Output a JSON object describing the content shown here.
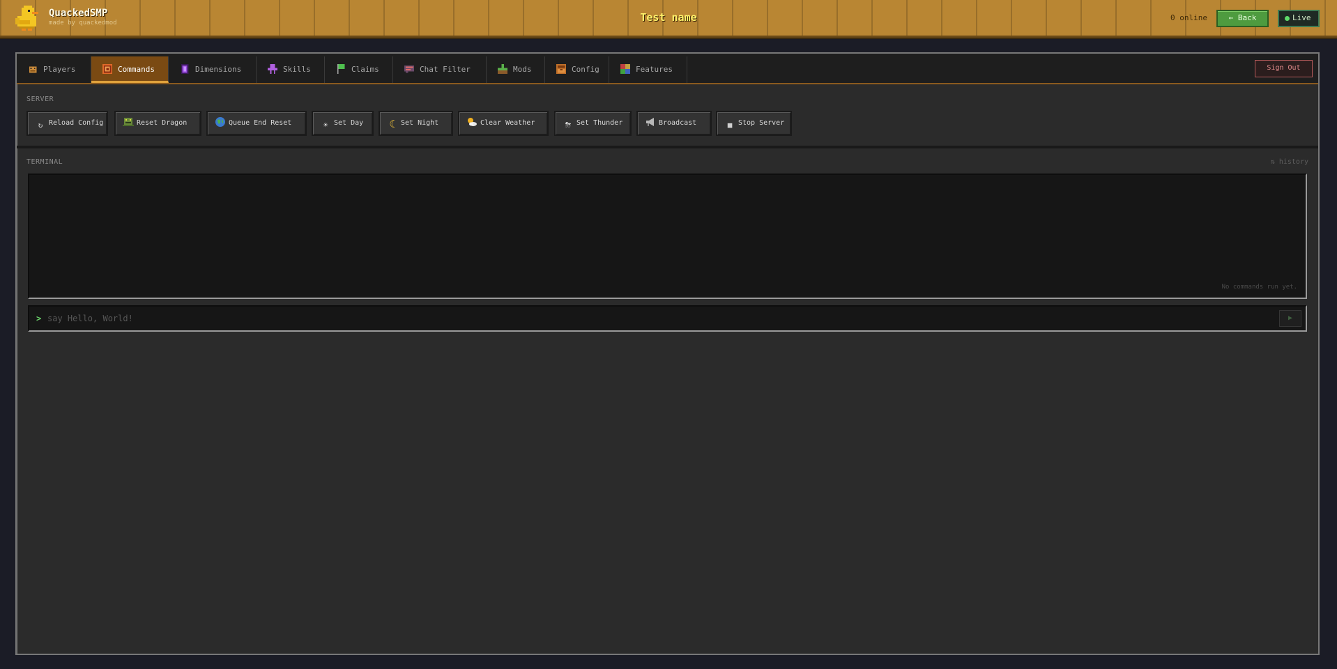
{
  "header": {
    "brand_name": "QuackedSMP",
    "brand_sub": "made by quackedmod",
    "page_title": "Test name",
    "online": "0 online",
    "back_label": "← Back",
    "live_label": "Live"
  },
  "tabs": [
    {
      "label": "Players",
      "icon": "players-icon",
      "active": false
    },
    {
      "label": "Commands",
      "icon": "commands-icon",
      "active": true
    },
    {
      "label": "Dimensions",
      "icon": "dimensions-icon",
      "active": false
    },
    {
      "label": "Skills",
      "icon": "skills-icon",
      "active": false
    },
    {
      "label": "Claims",
      "icon": "flag-icon",
      "active": false
    },
    {
      "label": "Chat Filter",
      "icon": "chat-filter-icon",
      "active": false
    },
    {
      "label": "Mods",
      "icon": "mods-icon",
      "active": false
    },
    {
      "label": "Config",
      "icon": "config-icon",
      "active": false
    },
    {
      "label": "Features",
      "icon": "features-icon",
      "active": false
    }
  ],
  "sign_out_label": "Sign Out",
  "server": {
    "section_label": "SERVER",
    "buttons": [
      {
        "label": "Reload Config",
        "icon": "reload-icon"
      },
      {
        "label": "Reset Dragon",
        "icon": "dragon-icon"
      },
      {
        "label": "Queue End Reset",
        "icon": "globe-icon"
      },
      {
        "label": "Set Day",
        "icon": "sun-icon"
      },
      {
        "label": "Set Night",
        "icon": "moon-icon"
      },
      {
        "label": "Clear Weather",
        "icon": "cloud-sun-icon"
      },
      {
        "label": "Set Thunder",
        "icon": "thunder-icon"
      },
      {
        "label": "Broadcast",
        "icon": "megaphone-icon"
      },
      {
        "label": "Stop Server",
        "icon": "stop-icon"
      }
    ]
  },
  "terminal": {
    "section_label": "TERMINAL",
    "history_label": "⇅ history",
    "empty_text": "No commands run yet.",
    "prompt": ">",
    "input_placeholder": "say Hello, World!",
    "send_label": "▶"
  },
  "colors": {
    "header_bg": "#b98633",
    "accent_tab": "#7a4a13",
    "back_green": "#4e9b3f",
    "title_yellow": "#fff06a"
  }
}
